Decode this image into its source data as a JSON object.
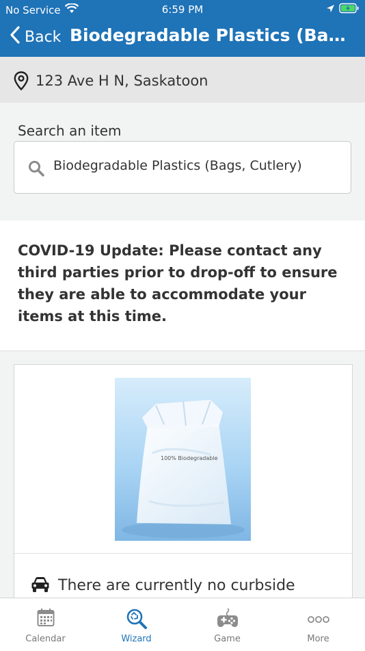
{
  "status_bar": {
    "carrier": "No Service",
    "time": "6:59 PM"
  },
  "nav": {
    "back_label": "Back",
    "title": "Biodegradable Plastics (Bags, Cutlery)"
  },
  "location": {
    "address": "123 Ave H  N, Saskatoon"
  },
  "search": {
    "label": "Search an item",
    "value": "Biodegradable Plastics (Bags, Cutlery)"
  },
  "notice": {
    "text": "COVID-19 Update: Please contact any third parties prior to drop-off to ensure they are able to accommodate your items at this time."
  },
  "item_card": {
    "image_caption": "100% Biodegradable",
    "curbside_text": "There are currently no curbside"
  },
  "tabs": [
    {
      "label": "Calendar",
      "icon": "calendar-icon",
      "active": false
    },
    {
      "label": "Wizard",
      "icon": "wizard-search-icon",
      "active": true
    },
    {
      "label": "Game",
      "icon": "gamepad-icon",
      "active": false
    },
    {
      "label": "More",
      "icon": "more-icon",
      "active": false
    }
  ],
  "colors": {
    "brand": "#1f73b7",
    "location_bg": "#e6e6e6",
    "tab_active": "#1f73b7",
    "tab_inactive": "#777777"
  }
}
